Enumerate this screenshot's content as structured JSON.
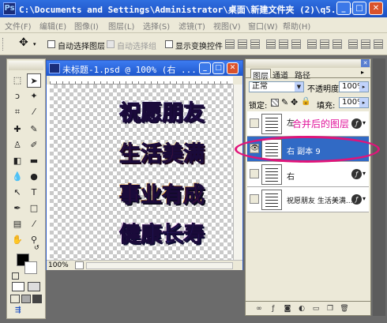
{
  "app": {
    "title": "C:\\Documents and Settings\\Administrator\\桌面\\新建文件夹 (2)\\q5.jpg",
    "icon": "Ps"
  },
  "window_controls": {
    "minimize": "_",
    "maximize": "□",
    "close": "✕"
  },
  "menu": [
    "文件(F)",
    "编辑(E)",
    "图像(I)",
    "图层(L)",
    "选择(S)",
    "滤镜(T)",
    "视图(V)",
    "窗口(W)",
    "帮助(H)"
  ],
  "options": {
    "auto_select_layer": "自动选择图层",
    "auto_select_group": "自动选择组",
    "show_transform": "显示变换控件"
  },
  "document": {
    "title": "未标题-1.psd @ 100% (右 ...",
    "zoom": "100%",
    "phrases": [
      "祝愿朋友",
      "生活美满",
      "事业有成",
      "健康长寿"
    ]
  },
  "layers": {
    "tabs": [
      "图层",
      "通道",
      "路径"
    ],
    "blend_mode": "正常",
    "opacity_label": "不透明度:",
    "opacity_value": "100%",
    "lock_label": "锁定:",
    "fill_label": "填充:",
    "fill_value": "100%",
    "items": [
      {
        "name": "左",
        "visible": false,
        "selected": false,
        "has_fx": true
      },
      {
        "name": "右 副本 9",
        "visible": true,
        "selected": true,
        "has_fx": false
      },
      {
        "name": "右",
        "visible": false,
        "selected": false,
        "has_fx": true
      },
      {
        "name": "祝愿朋友 生活美满...",
        "visible": false,
        "selected": false,
        "has_fx": true
      }
    ],
    "footer_icons": [
      "link-icon",
      "fx-icon",
      "mask-icon",
      "adjustment-icon",
      "folder-icon",
      "new-layer-icon",
      "trash-icon"
    ]
  },
  "annotation": "合并后的图层",
  "colors": {
    "annotation": "#e0129a",
    "selection": "#316ac5"
  }
}
